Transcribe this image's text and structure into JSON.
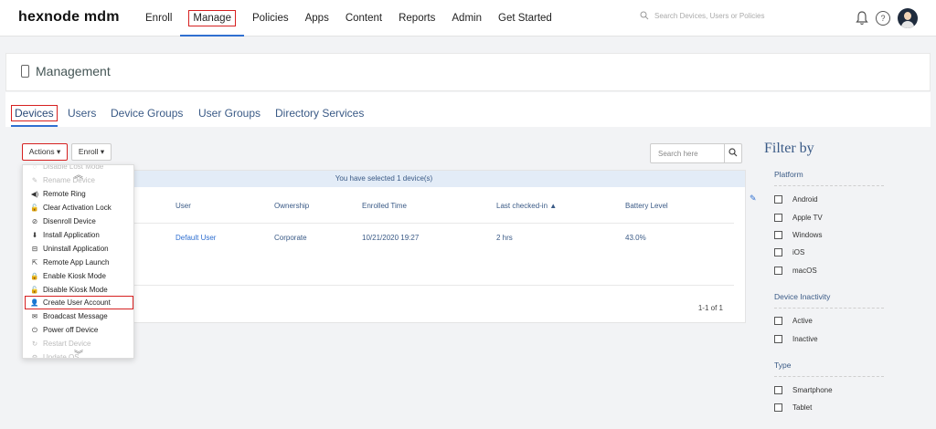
{
  "brand": {
    "logo": "hexnode mdm"
  },
  "nav": {
    "items": [
      "Enroll",
      "Manage",
      "Policies",
      "Apps",
      "Content",
      "Reports",
      "Admin",
      "Get Started"
    ],
    "active": "Manage"
  },
  "search_top": {
    "placeholder": "Search Devices, Users or Policies"
  },
  "page": {
    "title": "Management"
  },
  "tabs": [
    "Devices",
    "Users",
    "Device Groups",
    "User Groups",
    "Directory Services"
  ],
  "toolbar": {
    "actions_label": "Actions ▾",
    "enroll_label": "Enroll ▾",
    "search_placeholder": "Search here"
  },
  "table": {
    "selected_text": "You have selected 1 device(s)",
    "headers": [
      "User",
      "Ownership",
      "Enrolled Time",
      "Last checked-in ▲",
      "Battery Level"
    ],
    "row": [
      "Default User",
      "Corporate",
      "10/21/2020 19:27",
      "2 hrs",
      "43.0%"
    ],
    "pagination": "1-1 of 1"
  },
  "actions_menu": [
    {
      "label": "Disable Lost Mode",
      "icon": "lost-mode-icon",
      "glyph": "◌",
      "faded": true
    },
    {
      "label": "Rename Device",
      "icon": "rename-icon",
      "glyph": "✎",
      "faded": true
    },
    {
      "label": "Remote Ring",
      "icon": "speaker-icon",
      "glyph": "◀)"
    },
    {
      "label": "Clear Activation Lock",
      "icon": "unlock-icon",
      "glyph": "🔓"
    },
    {
      "label": "Disenroll Device",
      "icon": "disenroll-icon",
      "glyph": "⊘"
    },
    {
      "label": "Install Application",
      "icon": "download-icon",
      "glyph": "⬇"
    },
    {
      "label": "Uninstall Application",
      "icon": "uninstall-icon",
      "glyph": "⊟"
    },
    {
      "label": "Remote App Launch",
      "icon": "launch-icon",
      "glyph": "⇱"
    },
    {
      "label": "Enable Kiosk Mode",
      "icon": "lock-icon",
      "glyph": "🔒"
    },
    {
      "label": "Disable Kiosk Mode",
      "icon": "unlock-icon",
      "glyph": "🔓"
    },
    {
      "label": "Create User Account",
      "icon": "add-user-icon",
      "glyph": "👤",
      "highlight": true
    },
    {
      "label": "Broadcast Message",
      "icon": "message-icon",
      "glyph": "✉"
    },
    {
      "label": "Power off Device",
      "icon": "power-icon",
      "glyph": "⏻"
    },
    {
      "label": "Restart Device",
      "icon": "restart-icon",
      "glyph": "↻",
      "faded": true
    },
    {
      "label": "Update OS",
      "icon": "update-icon",
      "glyph": "⚙",
      "faded": true
    }
  ],
  "filter": {
    "title": "Filter by",
    "groups": [
      {
        "name": "Platform",
        "options": [
          "Android",
          "Apple TV",
          "Windows",
          "iOS",
          "macOS"
        ]
      },
      {
        "name": "Device Inactivity",
        "options": [
          "Active",
          "Inactive"
        ]
      },
      {
        "name": "Type",
        "options": [
          "Smartphone",
          "Tablet"
        ]
      }
    ]
  }
}
